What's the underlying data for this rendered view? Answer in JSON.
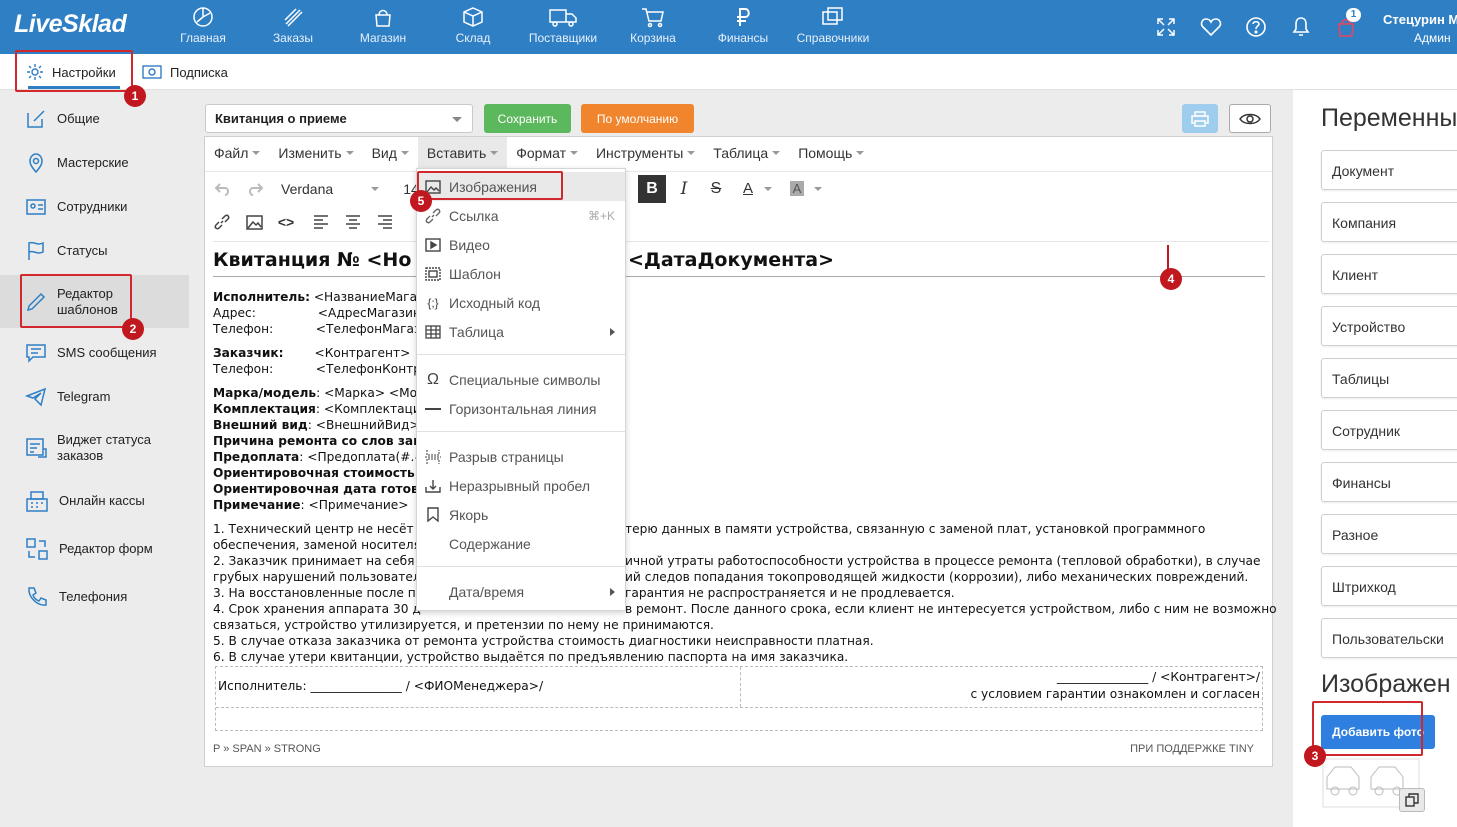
{
  "app": {
    "logo": "LiveSklad"
  },
  "nav": [
    {
      "label": "Главная",
      "icon": "dashboard-icon"
    },
    {
      "label": "Заказы",
      "icon": "orders-icon"
    },
    {
      "label": "Магазин",
      "icon": "store-icon"
    },
    {
      "label": "Склад",
      "icon": "warehouse-icon"
    },
    {
      "label": "Поставщики",
      "icon": "supplier-truck-icon"
    },
    {
      "label": "Корзина",
      "icon": "cart-icon"
    },
    {
      "label": "Финансы",
      "icon": "ruble-icon"
    },
    {
      "label": "Справочники",
      "icon": "directory-icon"
    }
  ],
  "header": {
    "cart_count": "1",
    "user_name": "Стецурин М",
    "user_role": "Админ"
  },
  "subnav": {
    "settings": "Настройки",
    "subscription": "Подписка"
  },
  "sidebar": {
    "items": [
      {
        "label": "Общие",
        "icon": "edit-icon"
      },
      {
        "label": "Мастерские",
        "icon": "location-icon"
      },
      {
        "label": "Сотрудники",
        "icon": "id-card-icon"
      },
      {
        "label": "Статусы",
        "icon": "flag-icon"
      },
      {
        "label": "Редактор шаблонов",
        "label1": "Редактор",
        "label2": "шаблонов",
        "icon": "pencil-icon"
      },
      {
        "label": "SMS сообщения",
        "icon": "sms-icon"
      },
      {
        "label": "Telegram",
        "icon": "telegram-icon"
      },
      {
        "label": "Виджет статуса заказов",
        "label1": "Виджет статуса",
        "label2": "заказов",
        "icon": "widget-icon"
      },
      {
        "label": "Онлайн кассы",
        "icon": "cash-register-icon"
      },
      {
        "label": "Редактор форм",
        "icon": "form-editor-icon"
      },
      {
        "label": "Телефония",
        "icon": "phone-icon"
      }
    ]
  },
  "template": {
    "selected": "Квитанция о приеме",
    "save_label": "Сохранить",
    "default_label": "По умолчанию"
  },
  "editor": {
    "menu": [
      "Файл",
      "Изменить",
      "Вид",
      "Вставить",
      "Формат",
      "Инструменты",
      "Таблица",
      "Помощь"
    ],
    "font": "Verdana",
    "font_size": "14",
    "doc": {
      "title": "Квитанция № <Но",
      "title_right": "<ДатаДокумента>",
      "lines": [
        {
          "b": "Исполнитель:",
          "t": " <НазваниеМагаз"
        },
        {
          "b": "",
          "t": "Адрес:                <АдресМагазин"
        },
        {
          "b": "",
          "t": "Телефон:           <ТелефонМагаз"
        },
        {
          "b": "Заказчик:",
          "t": "        <Контрагент>"
        },
        {
          "b": "",
          "t": "Телефон:           <ТелефонКонтр"
        },
        {
          "b": "Марка/модель",
          "t": ":  <Марка> <Мо"
        },
        {
          "b": "Комплектация",
          "t": ":  <Комплектаци"
        },
        {
          "b": "Внешний вид",
          "t": ": <ВнешнийВид>"
        },
        {
          "b": "Причина ремонта со слов зак",
          "t": ""
        },
        {
          "b": "Предоплата",
          "t": ": <Предоплата(#.#"
        },
        {
          "b": "Ориентировочная стоимость",
          "t": ""
        },
        {
          "b": "Ориентировочная дата готов",
          "t": ""
        },
        {
          "b": "Примечание",
          "t": ": <Примечание>"
        }
      ],
      "terms": [
        {
          "l": "1. Технический центр не несёт о",
          "r": "терю данных в памяти устройства, связанную с заменой плат, установкой программного"
        },
        {
          "l": "обеспечения, заменой носителя",
          "r": ""
        },
        {
          "l": "2. Заказчик принимает на себя р",
          "r": "ичной утраты работоспособности устройства в процессе ремонта (тепловой обработки), в случае"
        },
        {
          "l": "грубых нарушений пользователе",
          "r": "ий следов попадания токопроводящей жидкости (коррозии), либо механических повреждений."
        },
        {
          "l": "3. На восстановленные после по",
          "r": "гарантия не распространяется и не продлевается."
        },
        {
          "l": "4. Срок хранения аппарата 30 д",
          "r": "в ремонт. После данного срока, если клиент не интересуется устройством, либо с ним не возможно"
        },
        {
          "l": "связаться, устройство утилизируется, и претензии по нему не принимаются.",
          "r": ""
        },
        {
          "l": "5. В случае отказа заказчика от ремонта устройства стоимость диагностики неисправности платная.",
          "r": ""
        },
        {
          "l": "6. В случае утери квитанции, устройство выдаётся по предъявлению паспорта на имя заказчика.",
          "r": ""
        }
      ],
      "sig_left": "Исполнитель: _______________ / <ФИОМенеджера>/",
      "sig_right1": "_______________ / <Контрагент>/",
      "sig_right2": "с условием гарантии ознакомлен и согласен"
    },
    "status_path": "P » SPAN » STRONG",
    "status_brand": "ПРИ ПОДДЕРЖКЕ TINY"
  },
  "insert_menu": [
    {
      "label": "Изображения",
      "icon": "image-icon"
    },
    {
      "label": "Ссылка",
      "icon": "link-icon",
      "shortcut": "⌘+K"
    },
    {
      "label": "Видео",
      "icon": "video-icon"
    },
    {
      "label": "Шаблон",
      "icon": "template-icon"
    },
    {
      "label": "Исходный код",
      "icon": "source-code-icon"
    },
    {
      "label": "Таблица",
      "icon": "table-icon"
    },
    {
      "label": "Специальные символы",
      "icon": "omega-icon"
    },
    {
      "label": "Горизонтальная линия",
      "icon": "hr-icon"
    },
    {
      "label": "Разрыв страницы",
      "icon": "page-break-icon"
    },
    {
      "label": "Неразрывный пробел",
      "icon": "nbsp-icon"
    },
    {
      "label": "Якорь",
      "icon": "bookmark-icon"
    },
    {
      "label": "Содержание",
      "icon": ""
    },
    {
      "label": "Дата/время",
      "icon": ""
    }
  ],
  "variables": {
    "title": "Переменны",
    "items": [
      "Документ",
      "Компания",
      "Клиент",
      "Устройство",
      "Таблицы",
      "Сотрудник",
      "Финансы",
      "Разное",
      "Штрихкод",
      "Пользовательски"
    ]
  },
  "images": {
    "title": "Изображен",
    "add_label": "Добавить фото"
  },
  "annotations": [
    "1",
    "2",
    "3",
    "4",
    "5"
  ],
  "colors": {
    "brand": "#2f7fc5",
    "save": "#5cb85c",
    "default": "#f0852d",
    "annotation": "#d0282d",
    "add_photo": "#2f7fe0"
  }
}
